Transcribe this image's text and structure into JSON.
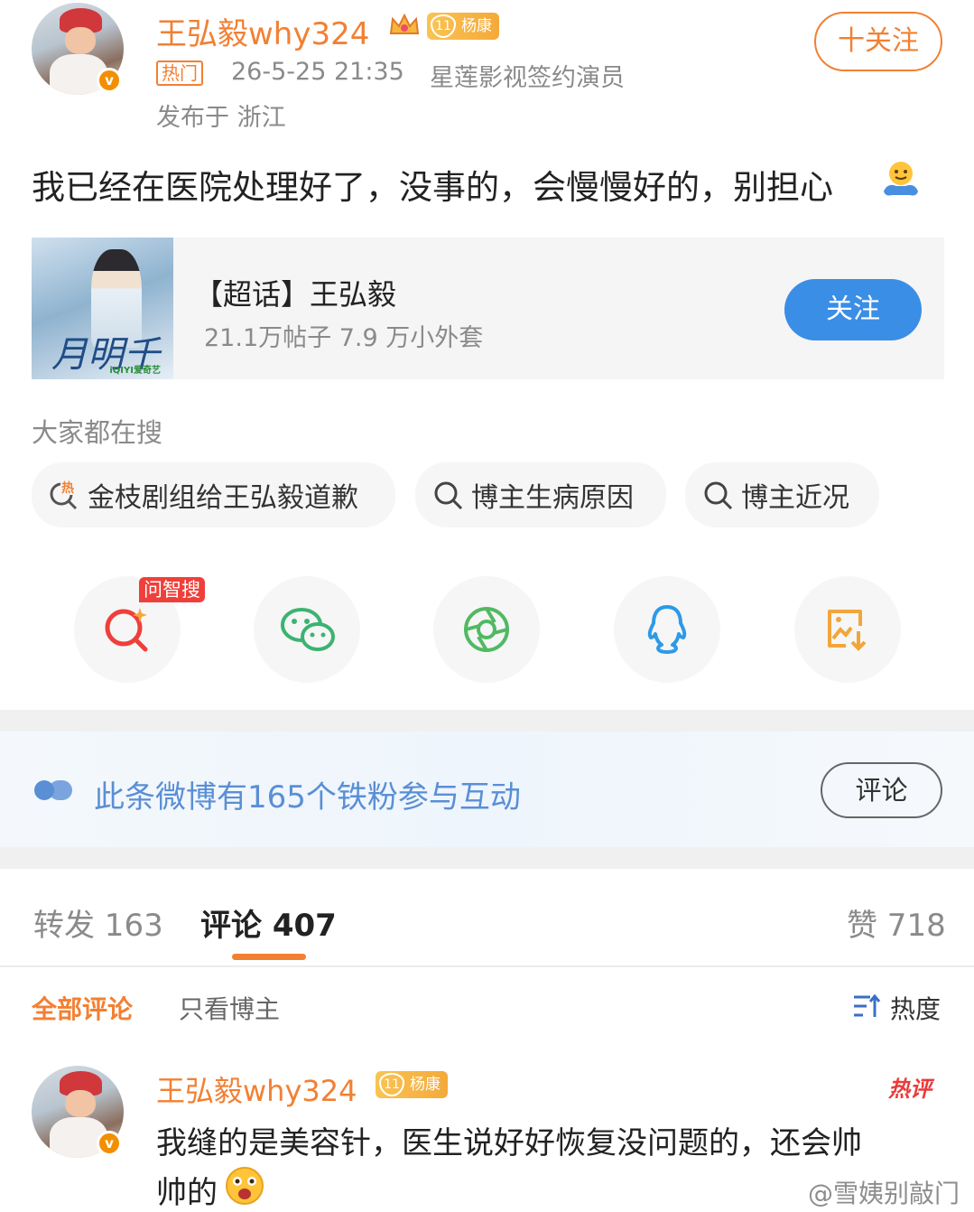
{
  "post": {
    "username": "王弘毅why324",
    "level_badge": "杨康",
    "level_num": "11",
    "hot_tag": "热门",
    "time": "26-5-25 21:35",
    "verify": "星莲影视签约演员",
    "location": "发布于 浙江",
    "follow_label": "十关注",
    "content": "我已经在医院处理好了，没事的，会慢慢好的，别担心"
  },
  "topic": {
    "title": "【超话】王弘毅",
    "stats": "21.1万帖子 7.9 万小外套",
    "follow_label": "关注",
    "image_calligraphy": "月明千里",
    "image_logo": "iQIYI爱奇艺"
  },
  "search": {
    "label": "大家都在搜",
    "chips": [
      "金枝剧组给王弘毅道歉",
      "博主生病原因",
      "博主近况"
    ]
  },
  "share": {
    "ai_tag": "问智搜",
    "icons": [
      "ai-search-icon",
      "wechat-icon",
      "moments-icon",
      "qq-icon",
      "save-image-icon"
    ]
  },
  "fans": {
    "text": "此条微博有165个铁粉参与互动",
    "comment_label": "评论"
  },
  "tabs": {
    "repost": "转发 163",
    "comments": "评论 407",
    "likes": "赞 718"
  },
  "filters": {
    "all": "全部评论",
    "author_only": "只看博主",
    "sort": "热度"
  },
  "comment": {
    "username": "王弘毅why324",
    "level_badge": "杨康",
    "level_num": "11",
    "hot_label": "热评",
    "text_line1": "我缝的是美容针，医生说好好恢复没问题的，还会帅",
    "text_line2": "帅的"
  },
  "watermark": "@雪姨别敲门",
  "colors": {
    "accent": "#f28033",
    "blue": "#3a8ee6",
    "fans_blue": "#5a8fd6",
    "hot_red": "#ea3b3b"
  }
}
